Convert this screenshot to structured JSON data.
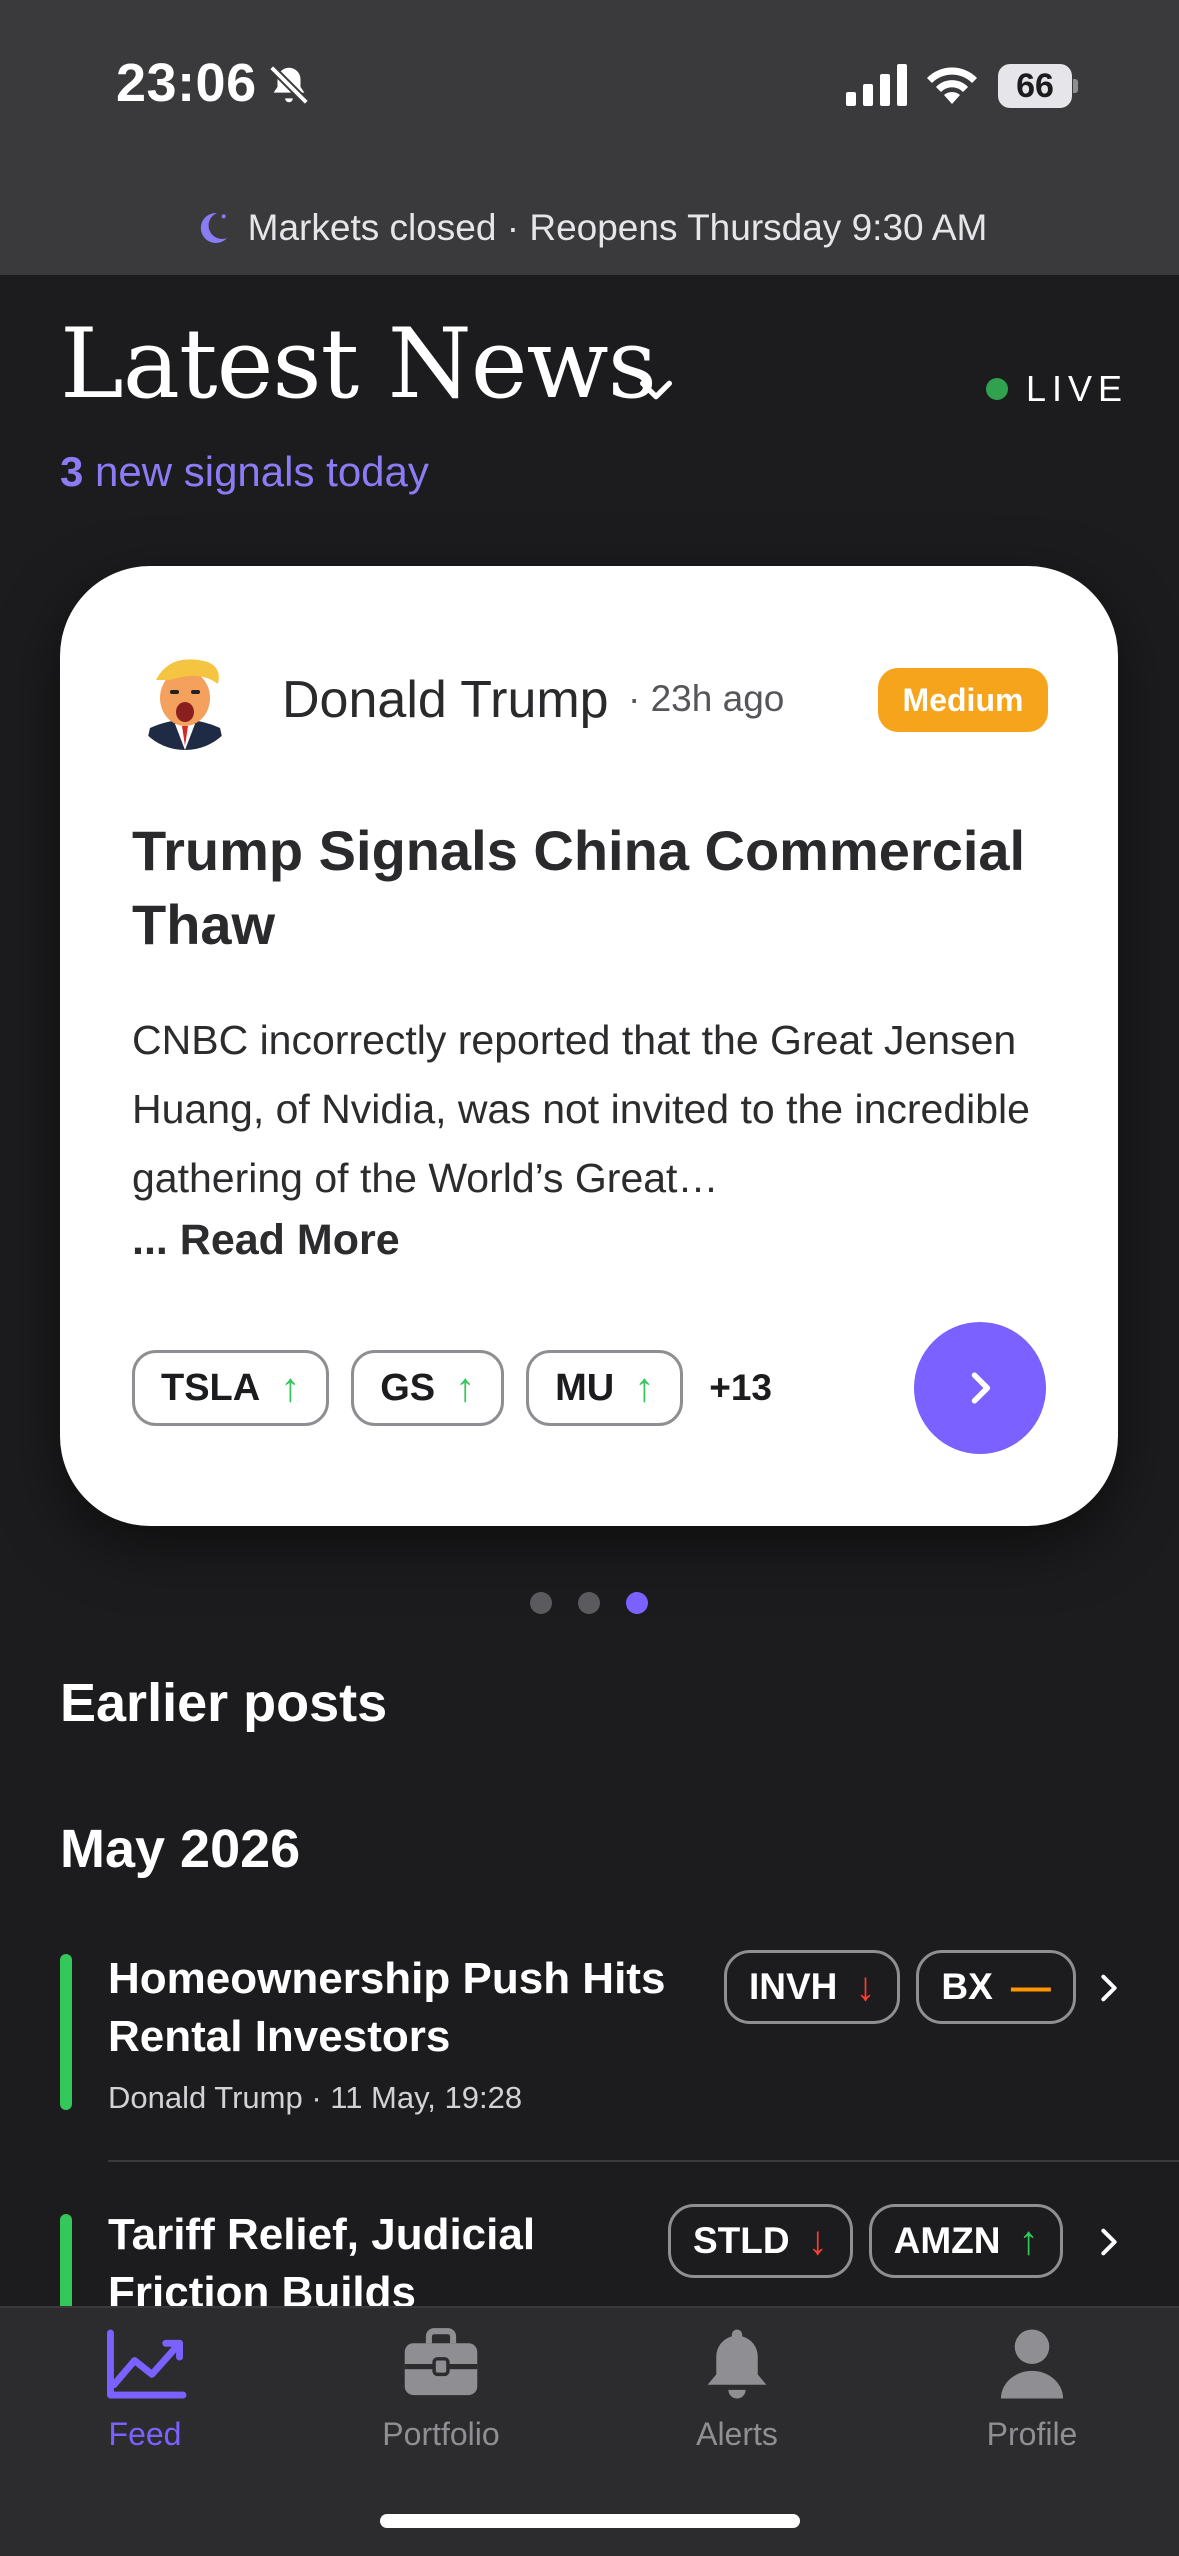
{
  "status_bar": {
    "time": "23:06",
    "battery": "66"
  },
  "market_banner": {
    "text": "Markets closed · Reopens Thursday 9:30 AM"
  },
  "header": {
    "title": "Latest News",
    "live_label": "LIVE",
    "signals_count": "3",
    "signals_text": " new signals today"
  },
  "featured": {
    "author": "Donald Trump",
    "time_ago": "· 23h ago",
    "impact": "Medium",
    "headline": "Trump Signals China Commercial Thaw",
    "body": "CNBC incorrectly reported that the Great Jensen Huang, of Nvidia, was not invited to the incredible gathering of the World’s Great…",
    "read_more": "... Read More",
    "tickers": [
      {
        "symbol": "TSLA",
        "direction": "up"
      },
      {
        "symbol": "GS",
        "direction": "up"
      },
      {
        "symbol": "MU",
        "direction": "up"
      }
    ],
    "more_count": "+13",
    "pager": {
      "count": 3,
      "active_index": 2
    }
  },
  "earlier": {
    "section_title": "Earlier posts",
    "month": "May 2026",
    "posts": [
      {
        "title": "Homeownership Push Hits Rental Investors",
        "meta": "Donald Trump · 11 May, 19:28",
        "tickers": [
          {
            "symbol": "INVH",
            "direction": "down"
          },
          {
            "symbol": "BX",
            "direction": "flat"
          }
        ]
      },
      {
        "title": "Tariff Relief, Judicial Friction Builds",
        "tickers": [
          {
            "symbol": "STLD",
            "direction": "down"
          },
          {
            "symbol": "AMZN",
            "direction": "up"
          }
        ]
      }
    ]
  },
  "tab_bar": {
    "tabs": [
      {
        "label": "Feed",
        "icon": "chart-line-icon",
        "active": true
      },
      {
        "label": "Portfolio",
        "icon": "briefcase-icon",
        "active": false
      },
      {
        "label": "Alerts",
        "icon": "bell-icon",
        "active": false
      },
      {
        "label": "Profile",
        "icon": "person-icon",
        "active": false
      }
    ]
  },
  "colors": {
    "accent": "#7b61ff",
    "impact_medium": "#f7a41d",
    "up": "#34c759",
    "down": "#ff3b30",
    "flat": "#ff9500"
  }
}
